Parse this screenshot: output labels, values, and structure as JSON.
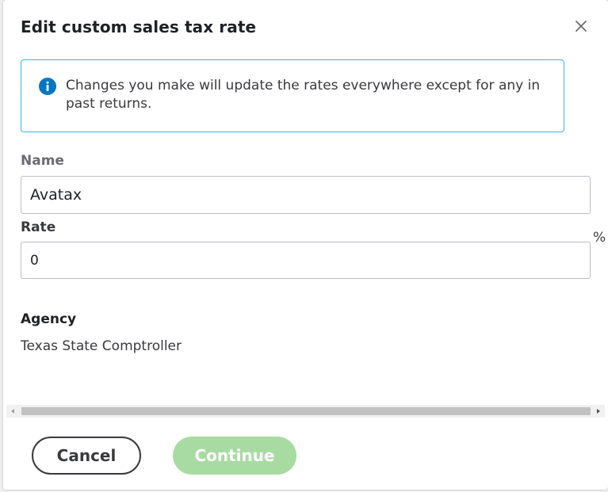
{
  "dialog": {
    "title": "Edit custom sales tax rate",
    "close_label": "×"
  },
  "info": {
    "message": "Changes you make will update the rates everywhere except for any in past returns."
  },
  "form": {
    "name_label": "Name",
    "name_value": "Avatax",
    "rate_label": "Rate",
    "rate_value": "0",
    "rate_unit": "%",
    "agency_label": "Agency",
    "agency_value": "Texas State Comptroller"
  },
  "actions": {
    "cancel_label": "Cancel",
    "continue_label": "Continue"
  },
  "colors": {
    "info_border": "#3fb3e0",
    "info_icon": "#0077c5",
    "continue_disabled": "#a8dba1",
    "text_dark": "#393a3d"
  },
  "icons": {
    "close": "close-icon",
    "info": "info-icon",
    "scroll_left": "triangle-left-icon",
    "scroll_right": "triangle-right-icon"
  }
}
